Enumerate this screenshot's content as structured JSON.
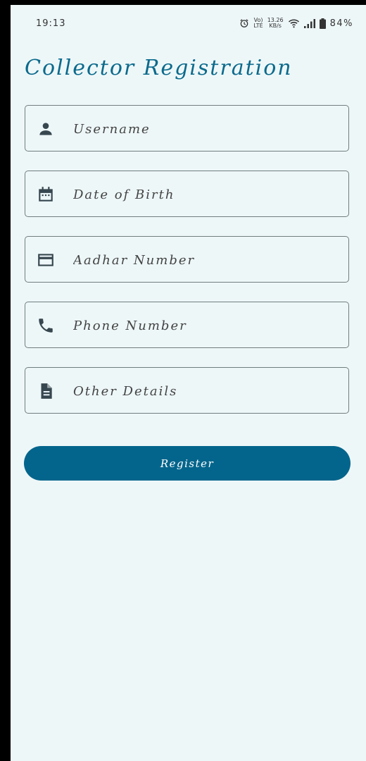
{
  "status_bar": {
    "time": "19:13",
    "speed_value": "13.26",
    "speed_unit": "KB/s",
    "volte_label": "Vo)",
    "lte_label": "LTE",
    "battery_percent": "84%"
  },
  "page": {
    "title": "Collector Registration"
  },
  "form": {
    "fields": [
      {
        "placeholder": "Username",
        "icon": "person-icon"
      },
      {
        "placeholder": "Date of Birth",
        "icon": "calendar-icon"
      },
      {
        "placeholder": "Aadhar Number",
        "icon": "credit-card-icon"
      },
      {
        "placeholder": "Phone Number",
        "icon": "phone-icon"
      },
      {
        "placeholder": "Other Details",
        "icon": "document-icon"
      }
    ],
    "register_label": "Register"
  },
  "colors": {
    "background": "#eef7f8",
    "accent": "#04658c",
    "title": "#0b6a8c",
    "icon": "#37474f",
    "border": "#6f7d80"
  }
}
